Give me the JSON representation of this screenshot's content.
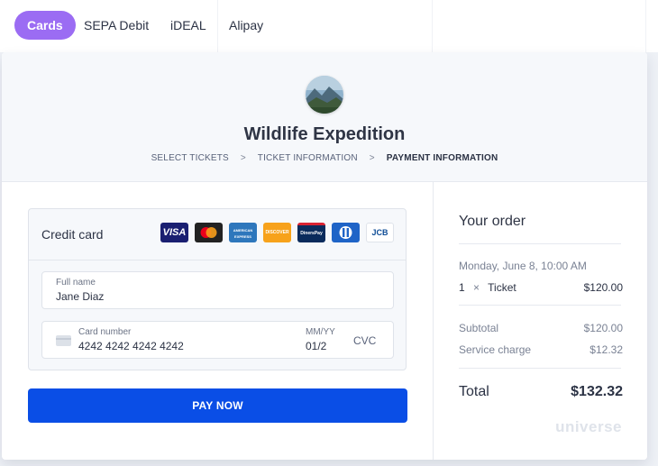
{
  "tabs": [
    {
      "label": "Cards"
    },
    {
      "label": "SEPA Debit"
    },
    {
      "label": "iDEAL"
    },
    {
      "label": "Alipay"
    }
  ],
  "event": {
    "title": "Wildlife Expedition"
  },
  "breadcrumb": {
    "step1": "SELECT TICKETS",
    "step2": "TICKET INFORMATION",
    "step3": "PAYMENT INFORMATION"
  },
  "payment": {
    "title": "Credit card",
    "brands": [
      {
        "name": "VISA",
        "color": "#1a1f71"
      },
      {
        "name": "",
        "color": "#222222"
      },
      {
        "name": "AMERICAN EXPRESS",
        "color": "#2e77bc"
      },
      {
        "name": "DISCOVER",
        "color": "#f7a21b"
      },
      {
        "name": "DinersPay",
        "color": "#0a2b5c"
      },
      {
        "name": "",
        "color": "#1f64c7"
      },
      {
        "name": "JCB",
        "color": "#ffffff"
      }
    ],
    "full_name_label": "Full name",
    "full_name_value": "Jane Diaz",
    "card_number_label": "Card number",
    "card_number_value": "4242 4242 4242 4242",
    "expiry_label": "MM/YY",
    "expiry_value": "01/2",
    "cvc_placeholder": "CVC",
    "pay_button": "PAY NOW"
  },
  "order": {
    "title": "Your order",
    "date": "Monday, June 8, 10:00 AM",
    "ticket_qty": "1",
    "ticket_x": "×",
    "ticket_label": "Ticket",
    "ticket_price": "$120.00",
    "subtotal_label": "Subtotal",
    "subtotal_value": "$120.00",
    "service_label": "Service charge",
    "service_value": "$12.32",
    "total_label": "Total",
    "total_value": "$132.32",
    "logo": "universe"
  },
  "colors": {
    "accent": "#9b6cf3",
    "primary": "#0a4ee6"
  }
}
